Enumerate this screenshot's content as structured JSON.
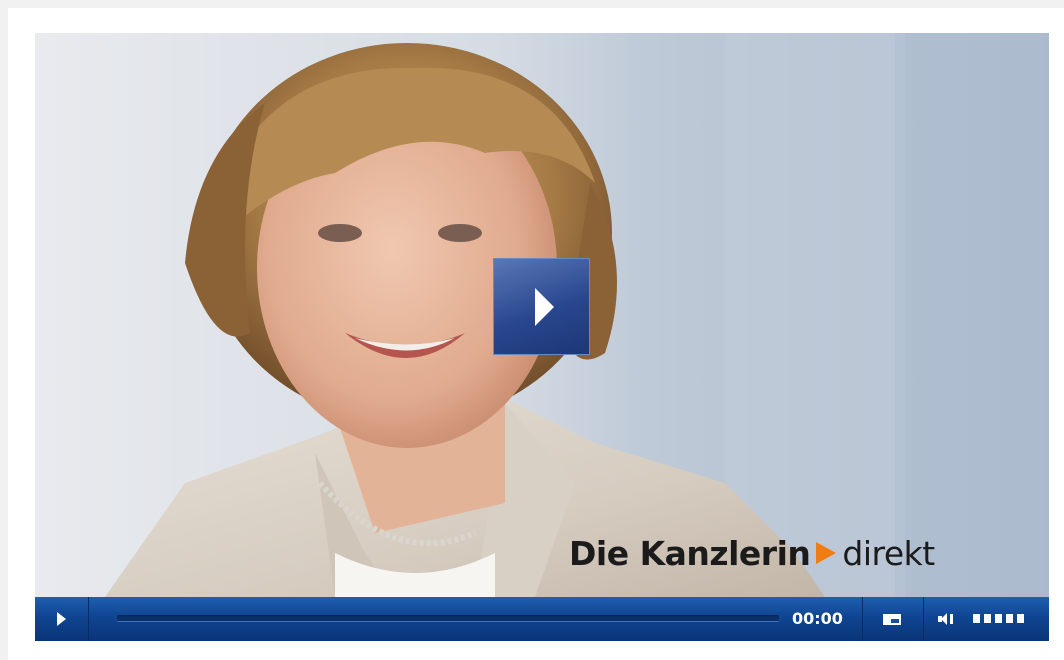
{
  "video": {
    "overlay_title": {
      "part1": "Die Kanzlerin",
      "part2": "direkt",
      "arrow_color": "#f07d12"
    }
  },
  "big_play_button": {
    "icon": "play-icon"
  },
  "controls": {
    "play_icon": "play-icon",
    "progress": 0,
    "time": "00:00",
    "screen_size_icon": "screen-size-icon",
    "volume_icon": "speaker-icon",
    "volume_level": 1.0,
    "volume_steps": 5
  },
  "colors": {
    "control_bar": "#0f4592",
    "big_play": "#29478e",
    "accent": "#f07d12"
  }
}
